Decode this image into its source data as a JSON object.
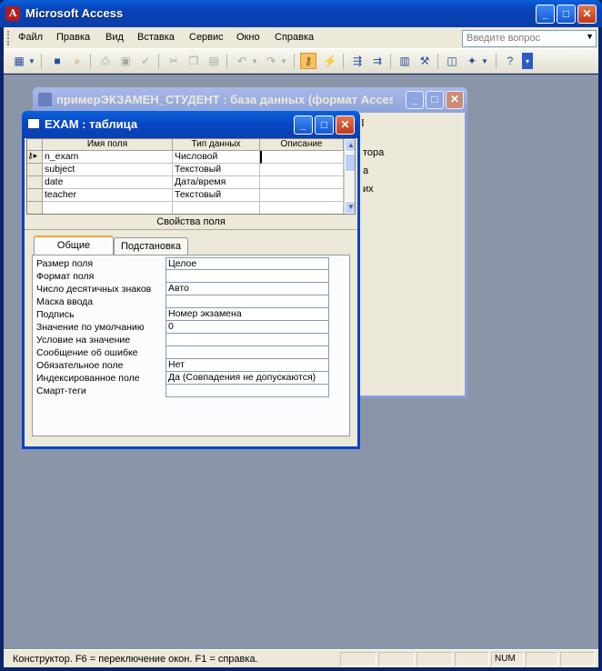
{
  "app": {
    "title": "Microsoft Access"
  },
  "menubar": {
    "items": [
      "Файл",
      "Правка",
      "Вид",
      "Вставка",
      "Сервис",
      "Окно",
      "Справка"
    ],
    "ask_placeholder": "Введите вопрос"
  },
  "db_window": {
    "title": "примерЭКЗАМЕН_СТУДЕНТ : база данных (формат Acces...",
    "visible_fragments": [
      "тора",
      "а",
      "их"
    ]
  },
  "table_window": {
    "title": "EXAM : таблица",
    "columns": [
      "Имя поля",
      "Тип данных",
      "Описание"
    ],
    "rows": [
      {
        "name": "n_exam",
        "type": "Числовой",
        "description": ""
      },
      {
        "name": "subject",
        "type": "Текстовый",
        "description": ""
      },
      {
        "name": "date",
        "type": "Дата/время",
        "description": ""
      },
      {
        "name": "teacher",
        "type": "Текстовый",
        "description": ""
      }
    ],
    "properties_title": "Свойства поля",
    "tabs": [
      "Общие",
      "Подстановка"
    ],
    "properties": [
      {
        "label": "Размер поля",
        "value": "Целое"
      },
      {
        "label": "Формат поля",
        "value": ""
      },
      {
        "label": "Число десятичных знаков",
        "value": "Авто"
      },
      {
        "label": "Маска ввода",
        "value": ""
      },
      {
        "label": "Подпись",
        "value": "Номер экзамена"
      },
      {
        "label": "Значение по умолчанию",
        "value": "0"
      },
      {
        "label": "Условие на значение",
        "value": ""
      },
      {
        "label": "Сообщение об ошибке",
        "value": ""
      },
      {
        "label": "Обязательное поле",
        "value": "Нет"
      },
      {
        "label": "Индексированное поле",
        "value": "Да (Совпадения не допускаются)"
      },
      {
        "label": "Смарт-теги",
        "value": ""
      }
    ]
  },
  "statusbar": {
    "text": "Конструктор.  F6 = переключение окон.  F1 = справка.",
    "num": "NUM"
  }
}
